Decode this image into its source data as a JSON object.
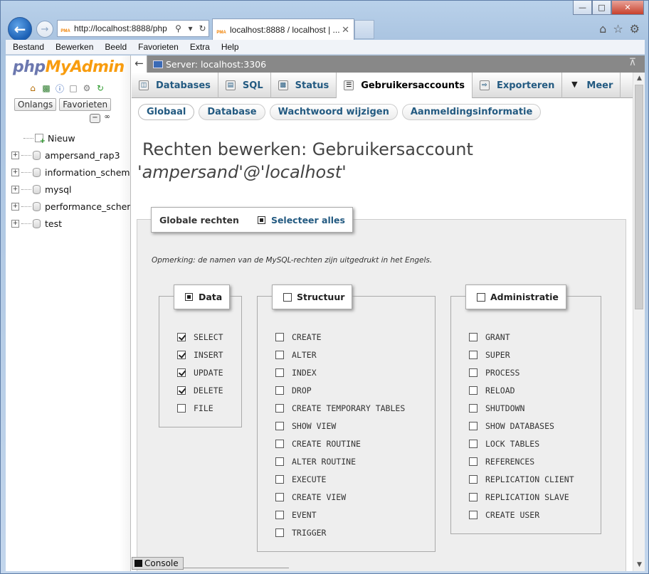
{
  "browser": {
    "address_url": "http://localhost:8888/php",
    "tab_title": "localhost:8888 / localhost | ...",
    "favicon_text": "PMA",
    "menu": [
      "Bestand",
      "Bewerken",
      "Beeld",
      "Favorieten",
      "Extra",
      "Help"
    ]
  },
  "nav": {
    "logo_part1": "php",
    "logo_part2": "MyAdmin",
    "recent_label": "Onlangs",
    "favorites_label": "Favorieten",
    "tree": [
      {
        "label": "Nieuw",
        "type": "new"
      },
      {
        "label": "ampersand_rap3",
        "type": "db"
      },
      {
        "label": "information_schema",
        "type": "db"
      },
      {
        "label": "mysql",
        "type": "db"
      },
      {
        "label": "performance_schema",
        "type": "db"
      },
      {
        "label": "test",
        "type": "db"
      }
    ]
  },
  "server": {
    "label": "Server: localhost:3306"
  },
  "topmenu": [
    {
      "label": "Databases",
      "icon": "databases-icon"
    },
    {
      "label": "SQL",
      "icon": "sql-icon"
    },
    {
      "label": "Status",
      "icon": "status-icon"
    },
    {
      "label": "Gebruikersaccounts",
      "icon": "users-icon",
      "active": true
    },
    {
      "label": "Exporteren",
      "icon": "export-icon"
    },
    {
      "label": "Meer",
      "icon": "chevron-down-icon"
    }
  ],
  "subtabs": [
    {
      "label": "Globaal",
      "active": true
    },
    {
      "label": "Database"
    },
    {
      "label": "Wachtwoord wijzigen"
    },
    {
      "label": "Aanmeldingsinformatie"
    }
  ],
  "page": {
    "title": "Rechten bewerken: Gebruikersaccount",
    "subtitle": "'ampersand'@'localhost'"
  },
  "privileges": {
    "legend": "Globale rechten",
    "select_all": "Selecteer alles",
    "note": "Opmerking: de namen van de MySQL-rechten zijn uitgedrukt in het Engels.",
    "groups": [
      {
        "title": "Data",
        "state": "mixed",
        "items": [
          {
            "label": "SELECT",
            "checked": true
          },
          {
            "label": "INSERT",
            "checked": true
          },
          {
            "label": "UPDATE",
            "checked": true
          },
          {
            "label": "DELETE",
            "checked": true
          },
          {
            "label": "FILE",
            "checked": false
          }
        ]
      },
      {
        "title": "Structuur",
        "state": "empty",
        "items": [
          {
            "label": "CREATE",
            "checked": false
          },
          {
            "label": "ALTER",
            "checked": false
          },
          {
            "label": "INDEX",
            "checked": false
          },
          {
            "label": "DROP",
            "checked": false
          },
          {
            "label": "CREATE TEMPORARY TABLES",
            "checked": false
          },
          {
            "label": "SHOW VIEW",
            "checked": false
          },
          {
            "label": "CREATE ROUTINE",
            "checked": false
          },
          {
            "label": "ALTER ROUTINE",
            "checked": false
          },
          {
            "label": "EXECUTE",
            "checked": false
          },
          {
            "label": "CREATE VIEW",
            "checked": false
          },
          {
            "label": "EVENT",
            "checked": false
          },
          {
            "label": "TRIGGER",
            "checked": false
          }
        ]
      },
      {
        "title": "Administratie",
        "state": "empty",
        "items": [
          {
            "label": "GRANT",
            "checked": false
          },
          {
            "label": "SUPER",
            "checked": false
          },
          {
            "label": "PROCESS",
            "checked": false
          },
          {
            "label": "RELOAD",
            "checked": false
          },
          {
            "label": "SHUTDOWN",
            "checked": false
          },
          {
            "label": "SHOW DATABASES",
            "checked": false
          },
          {
            "label": "LOCK TABLES",
            "checked": false
          },
          {
            "label": "REFERENCES",
            "checked": false
          },
          {
            "label": "REPLICATION CLIENT",
            "checked": false
          },
          {
            "label": "REPLICATION SLAVE",
            "checked": false
          },
          {
            "label": "CREATE USER",
            "checked": false
          }
        ]
      }
    ]
  },
  "console_label": "Console"
}
